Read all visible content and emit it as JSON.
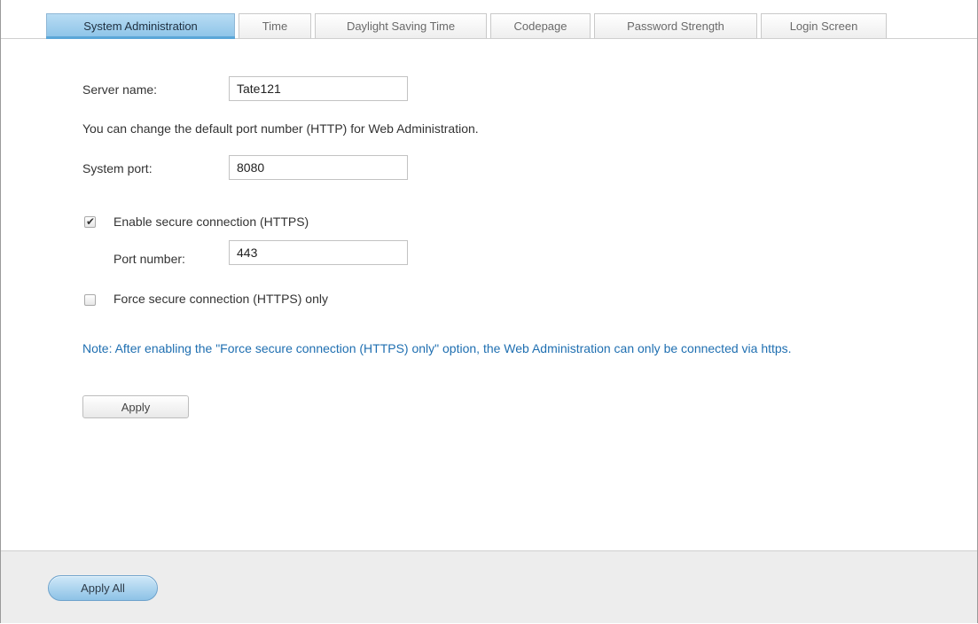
{
  "tabs": [
    {
      "label": "System Administration",
      "active": true
    },
    {
      "label": "Time",
      "active": false
    },
    {
      "label": "Daylight Saving Time",
      "active": false
    },
    {
      "label": "Codepage",
      "active": false
    },
    {
      "label": "Password Strength",
      "active": false
    },
    {
      "label": "Login Screen",
      "active": false
    }
  ],
  "form": {
    "server_name_label": "Server name:",
    "server_name_value": "Tate121",
    "port_hint": "You can change the default port number (HTTP) for Web Administration.",
    "system_port_label": "System port:",
    "system_port_value": "8080",
    "secure_connection_label": "Enable secure connection (HTTPS)",
    "secure_connection_checked": true,
    "port_number_label": "Port number:",
    "port_number_value": "443",
    "force_secure_label": "Force secure connection (HTTPS) only",
    "force_secure_checked": false,
    "note": "Note: After enabling the \"Force secure connection (HTTPS) only\" option, the Web Administration can only be connected via https.",
    "apply_label": "Apply"
  },
  "footer": {
    "apply_all_label": "Apply All"
  },
  "colors": {
    "active_tab": "#8cc3e8",
    "note_text": "#1f6fb1",
    "footer_bg": "#ededed"
  }
}
